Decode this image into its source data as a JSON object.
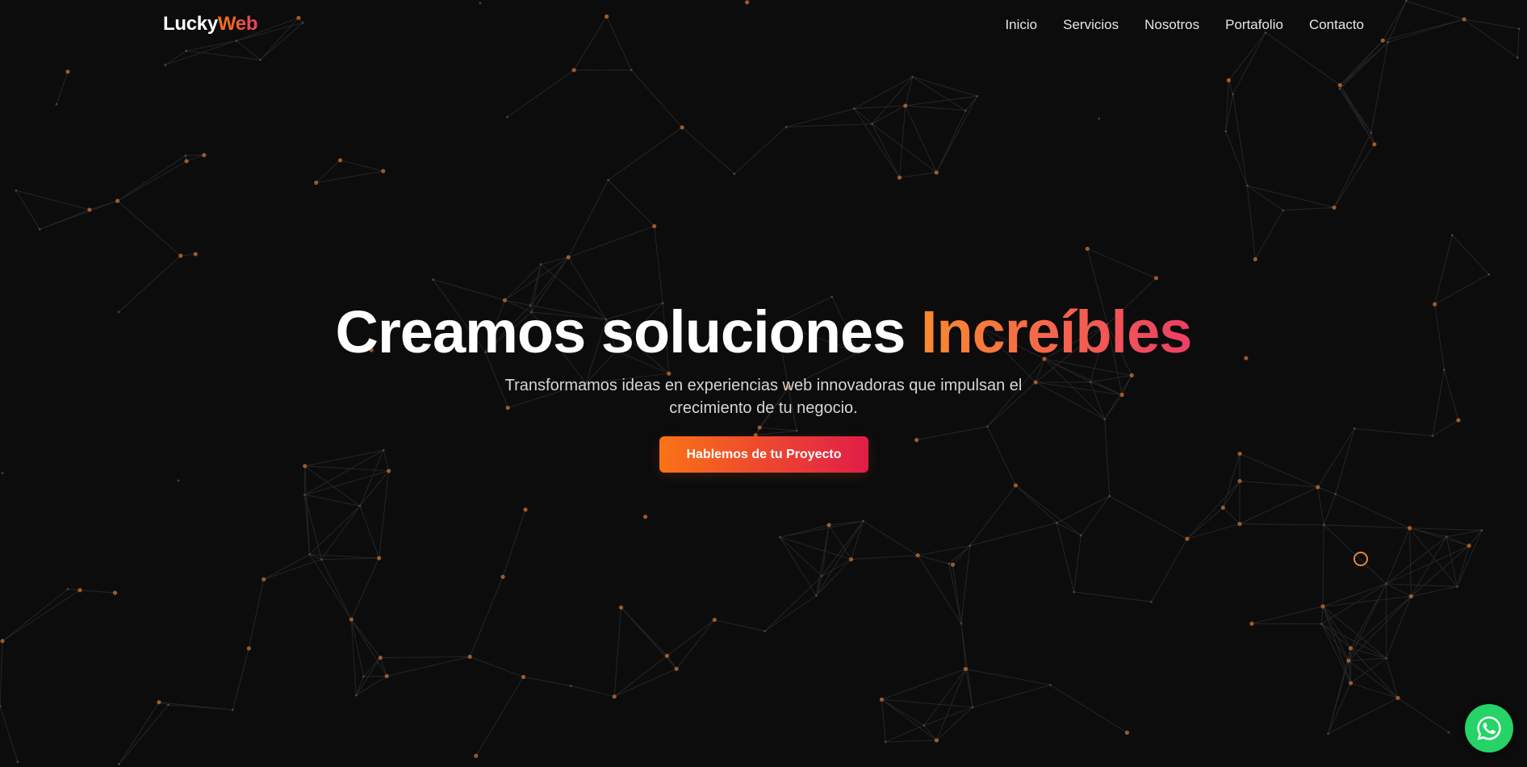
{
  "navbar": {
    "logo_part1": "Lucky",
    "logo_part2": "Web",
    "links": [
      "Inicio",
      "Servicios",
      "Nosotros",
      "Portafolio",
      "Contacto"
    ]
  },
  "hero": {
    "headline_main": "Creamos soluciones",
    "headline_accent": "Increíbles",
    "subtitle": "Transformamos ideas en experiencias web innovadoras que impulsan el crecimiento de tu negocio.",
    "cta_label": "Hablemos de tu Proyecto"
  },
  "icons": {
    "whatsapp": "whatsapp-icon",
    "cursor": "cursor-ring-icon"
  },
  "colors": {
    "background": "#0c0c0c",
    "accent_orange": "#f97316",
    "accent_pink": "#e11d48",
    "node": "#c8702d",
    "whatsapp_green": "#25d366"
  }
}
